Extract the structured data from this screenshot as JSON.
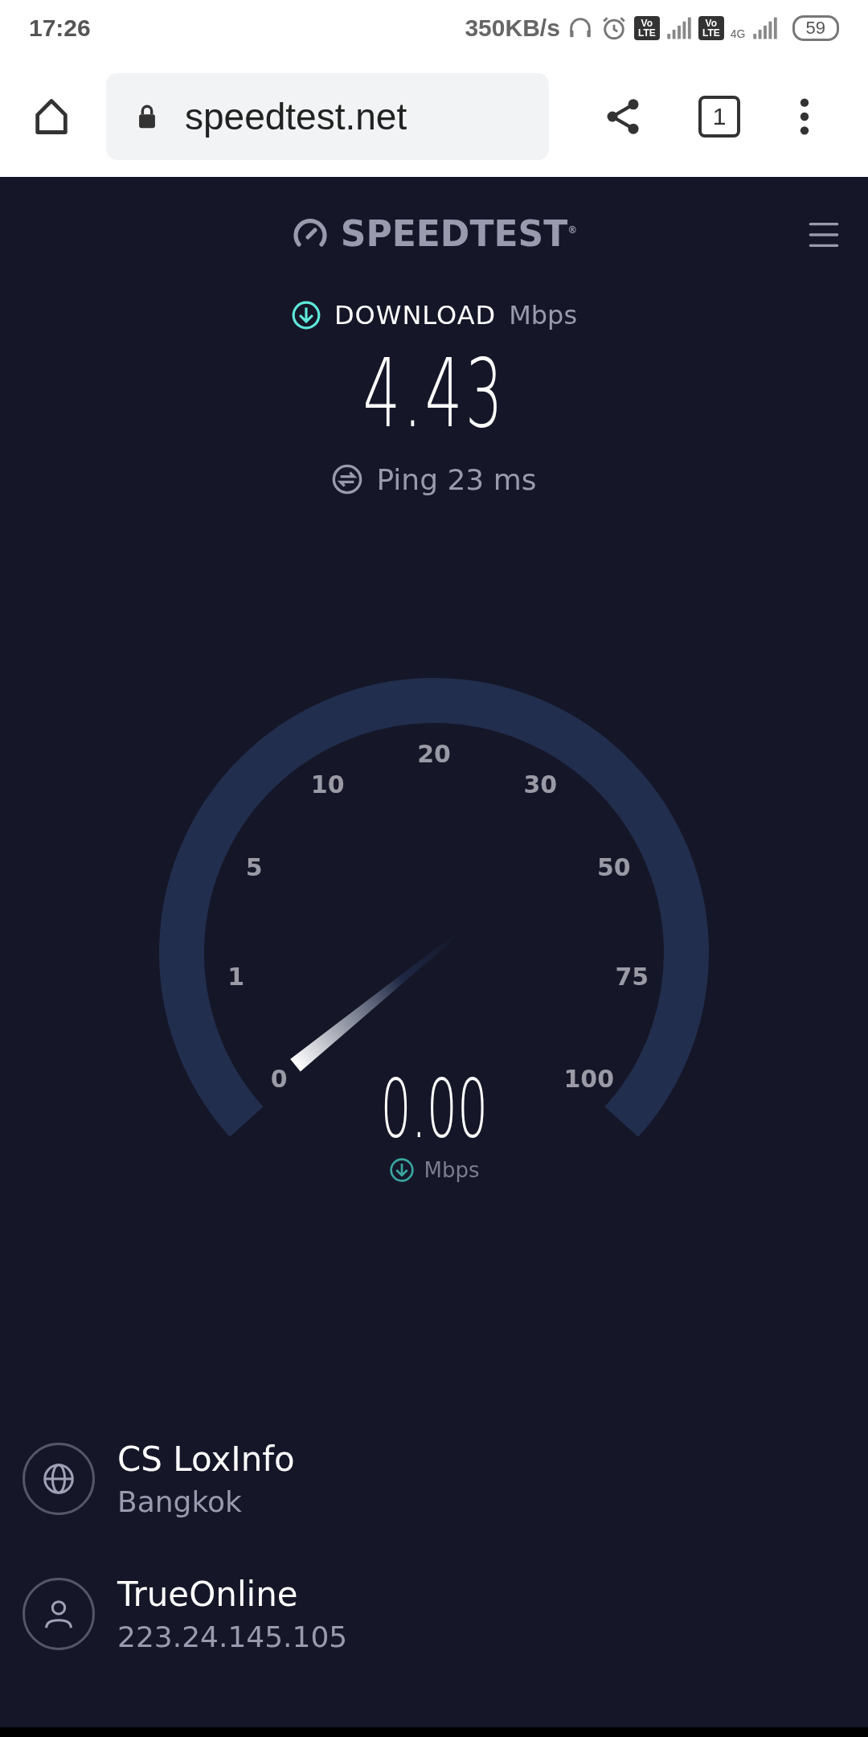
{
  "status_bar": {
    "time": "17:26",
    "net_speed": "350KB/s",
    "sim_badges": [
      {
        "top": "Vo",
        "bottom": "LTE"
      },
      {
        "top": "Vo",
        "bottom": "LTE"
      }
    ],
    "network_type": "4G",
    "battery": "59"
  },
  "browser": {
    "url": "speedtest.net",
    "tab_count": "1"
  },
  "header": {
    "logo": "SPEEDTEST$^{®}$"
  },
  "result": {
    "label": "DOWNLOAD",
    "unit": "Mbps",
    "value": "4.43",
    "ping": "Ping 23 ms"
  },
  "gauge": {
    "ticks": [
      "0",
      "1",
      "5",
      "10",
      "20",
      "30",
      "50",
      "75",
      "100"
    ],
    "reading": "0.00",
    "unit": "Mbps"
  },
  "servers": [
    {
      "kind": "host",
      "name": "CS LoxInfo",
      "detail": "Bangkok"
    },
    {
      "kind": "client",
      "name": "TrueOnline",
      "detail": "223.24.145.105"
    }
  ]
}
